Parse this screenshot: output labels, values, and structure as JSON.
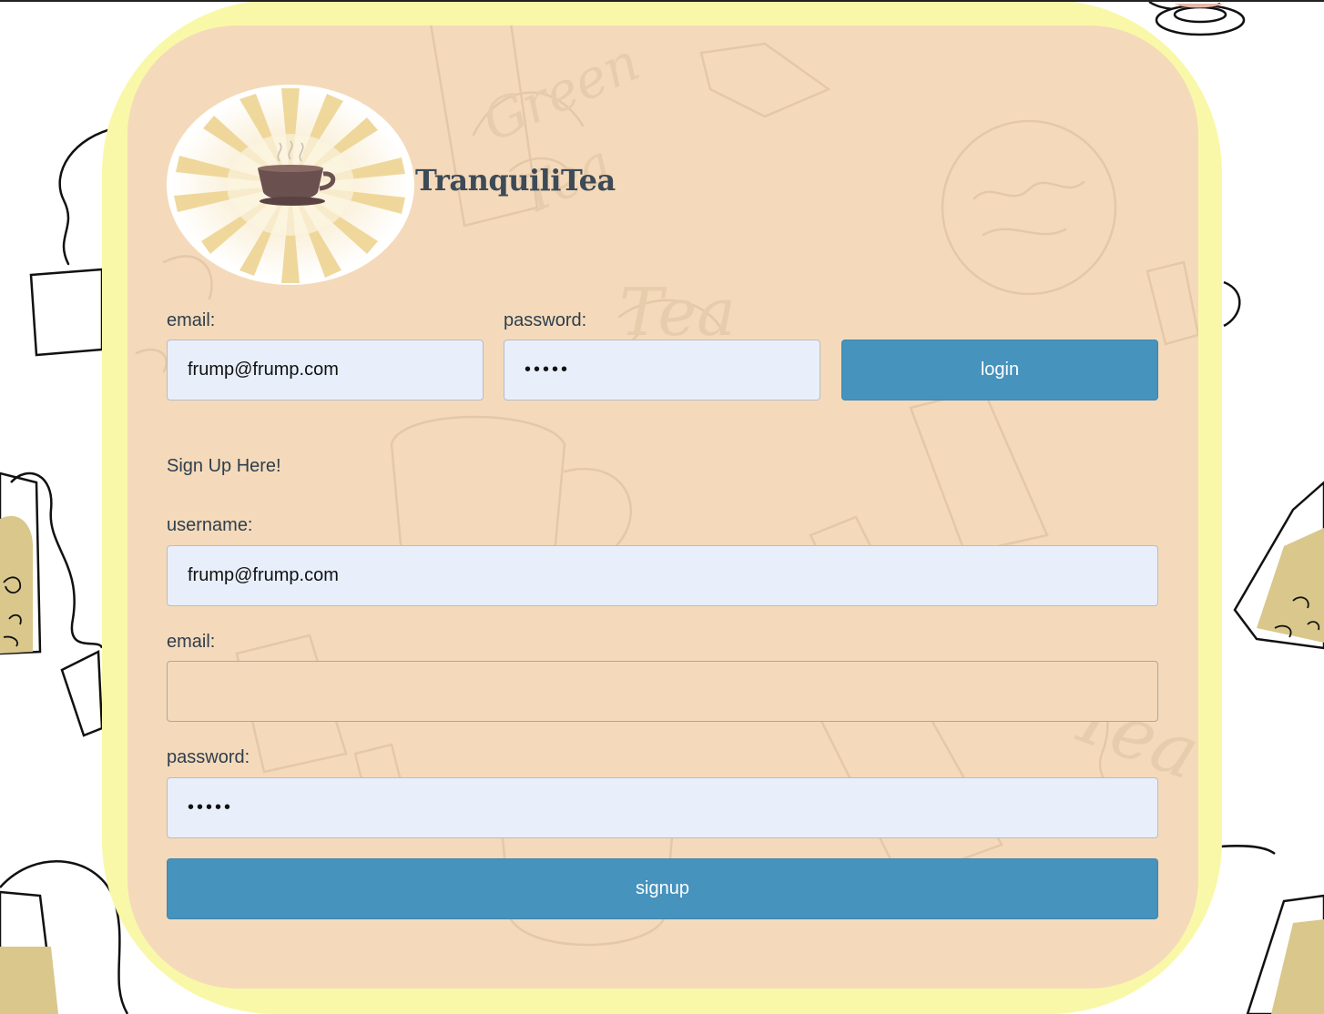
{
  "brand": {
    "name": "TranquiliTea"
  },
  "login": {
    "email_label": "email:",
    "email_value": "frump@frump.com",
    "password_label": "password:",
    "password_value": "•••••",
    "button_label": "login"
  },
  "signup": {
    "heading": "Sign Up Here!",
    "username_label": "username:",
    "username_value": "frump@frump.com",
    "email_label": "email:",
    "email_value": "",
    "password_label": "password:",
    "password_value": "•••••",
    "button_label": "signup"
  },
  "colors": {
    "card_background": "#f4dabb",
    "card_border": "#f9f8a8",
    "button": "#4693bd",
    "input_fill": "#e8effb",
    "text": "#2e3e4c"
  },
  "icons": {
    "logo": "teacup-sunburst-logo"
  }
}
